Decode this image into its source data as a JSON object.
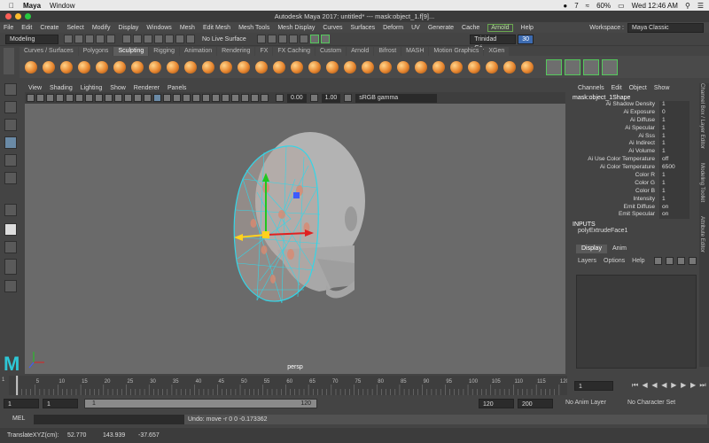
{
  "mac_menubar": {
    "app_name": "Maya",
    "menu": "Window",
    "badge_count": "7",
    "battery": "60%",
    "clock": "Wed 12:46 AM"
  },
  "window": {
    "title": "Autodesk Maya 2017: untitled*   ---   mask:object_1.f[9]..."
  },
  "maya_menu": {
    "items": [
      "File",
      "Edit",
      "Create",
      "Select",
      "Modify",
      "Display",
      "Windows",
      "Mesh",
      "Edit Mesh",
      "Mesh Tools",
      "Mesh Display",
      "Curves",
      "Surfaces",
      "Deform",
      "UV",
      "Generate",
      "Cache"
    ],
    "arnold": "Arnold",
    "help": "Help",
    "workspace_label": "Workspace :",
    "workspace_value": "Maya Classic"
  },
  "status_line": {
    "mode": "Modeling",
    "live_surface": "No Live Surface",
    "user": "Trinidad Gó...",
    "credits": "30"
  },
  "shelf": {
    "tabs": [
      "Curves / Surfaces",
      "Polygons",
      "Sculpting",
      "Rigging",
      "Animation",
      "Rendering",
      "FX",
      "FX Caching",
      "Custom",
      "Arnold",
      "Bifrost",
      "MASH",
      "Motion Graphics",
      "XGen"
    ],
    "active_tab": "Sculpting"
  },
  "viewport": {
    "menu": [
      "View",
      "Shading",
      "Lighting",
      "Show",
      "Renderer",
      "Panels"
    ],
    "exposure": "0.00",
    "gamma": "1.00",
    "color_space": "sRGB gamma",
    "camera_label": "persp"
  },
  "channel_box": {
    "menu": [
      "Channels",
      "Edit",
      "Object",
      "Show"
    ],
    "object": "mask:object_1Shape",
    "attributes": [
      {
        "label": "Ai Shadow Density",
        "value": "1"
      },
      {
        "label": "Ai Exposure",
        "value": "0"
      },
      {
        "label": "Ai Diffuse",
        "value": "1"
      },
      {
        "label": "Ai Specular",
        "value": "1"
      },
      {
        "label": "Ai Sss",
        "value": "1"
      },
      {
        "label": "Ai Indirect",
        "value": "1"
      },
      {
        "label": "Ai Volume",
        "value": "1"
      },
      {
        "label": "Ai Use Color Temperature",
        "value": "off"
      },
      {
        "label": "Ai Color Temperature",
        "value": "6500"
      },
      {
        "label": "Color R",
        "value": "1"
      },
      {
        "label": "Color G",
        "value": "1"
      },
      {
        "label": "Color B",
        "value": "1"
      },
      {
        "label": "Intensity",
        "value": "1"
      },
      {
        "label": "Emit Diffuse",
        "value": "on"
      },
      {
        "label": "Emit Specular",
        "value": "on"
      }
    ],
    "inputs_header": "INPUTS",
    "inputs_node": "polyExtrudeFace1"
  },
  "side_tabs": [
    "Channel Box / Layer Editor",
    "Modeling Toolkit",
    "Attribute Editor"
  ],
  "layer_editor": {
    "tabs": [
      "Display",
      "Anim"
    ],
    "active_tab": "Display",
    "menu": [
      "Layers",
      "Options",
      "Help"
    ]
  },
  "timeline": {
    "ticks": [
      "5",
      "10",
      "15",
      "20",
      "25",
      "30",
      "35",
      "40",
      "45",
      "50",
      "55",
      "60",
      "65",
      "70",
      "75",
      "80",
      "85",
      "90",
      "95",
      "100",
      "105",
      "110",
      "115",
      "120"
    ],
    "start_tick": "1",
    "current_frame": "1"
  },
  "range": {
    "start": "1",
    "current": "1",
    "slider_start": "1",
    "slider_end": "120",
    "end": "120",
    "max": "200",
    "anim_layer": "No Anim Layer",
    "character_set": "No Character Set"
  },
  "command_line": {
    "label": "MEL",
    "result": "Undo: move -r 0 0 -0.173362"
  },
  "help_line": {
    "label": "TranslateXYZ(cm):",
    "x": "52.770",
    "y": "143.939",
    "z": "-37.657"
  },
  "colors": {
    "wireframe": "#33d6e8",
    "axis_x": "#e02020",
    "axis_y": "#1fc81f",
    "axis_z": "#3d5bff",
    "shelf_icon": "#e7862f",
    "maya_logo": "#2ec7d6"
  }
}
